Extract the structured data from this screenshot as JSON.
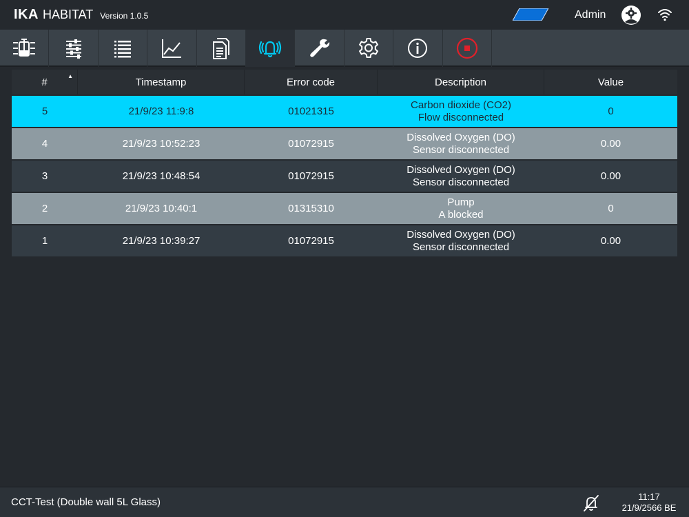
{
  "header": {
    "brand": "IKA",
    "product": "HABITAT",
    "version": "Version 1.0.5",
    "user": "Admin",
    "accent_color": "#0a6fd8"
  },
  "nav": {
    "items": [
      {
        "icon": "bioreactor-icon"
      },
      {
        "icon": "sliders-icon"
      },
      {
        "icon": "list-icon"
      },
      {
        "icon": "chart-icon"
      },
      {
        "icon": "documents-icon"
      },
      {
        "icon": "alarm-bell-icon",
        "active": true
      },
      {
        "icon": "wrench-icon"
      },
      {
        "icon": "gear-icon"
      },
      {
        "icon": "info-icon"
      },
      {
        "icon": "stop-icon"
      }
    ]
  },
  "table": {
    "headers": [
      "#",
      "Timestamp",
      "Error code",
      "Description",
      "Value"
    ],
    "sort_indicator": "▲",
    "rows": [
      {
        "num": "5",
        "timestamp": "21/9/23 11:9:8",
        "code": "01021315",
        "desc1": "Carbon dioxide (CO2)",
        "desc2": "Flow disconnected",
        "value": "0",
        "style": "selected"
      },
      {
        "num": "4",
        "timestamp": "21/9/23 10:52:23",
        "code": "01072915",
        "desc1": "Dissolved Oxygen (DO)",
        "desc2": "Sensor disconnected",
        "value": "0.00",
        "style": "light"
      },
      {
        "num": "3",
        "timestamp": "21/9/23 10:48:54",
        "code": "01072915",
        "desc1": "Dissolved Oxygen (DO)",
        "desc2": "Sensor disconnected",
        "value": "0.00",
        "style": "dark"
      },
      {
        "num": "2",
        "timestamp": "21/9/23 10:40:1",
        "code": "01315310",
        "desc1": "Pump",
        "desc2": "A blocked",
        "value": "0",
        "style": "light"
      },
      {
        "num": "1",
        "timestamp": "21/9/23 10:39:27",
        "code": "01072915",
        "desc1": "Dissolved Oxygen (DO)",
        "desc2": "Sensor disconnected",
        "value": "0.00",
        "style": "dark"
      }
    ]
  },
  "footer": {
    "device": "CCT-Test (Double wall 5L Glass)",
    "time": "11:17",
    "date": "21/9/2566 BE"
  }
}
